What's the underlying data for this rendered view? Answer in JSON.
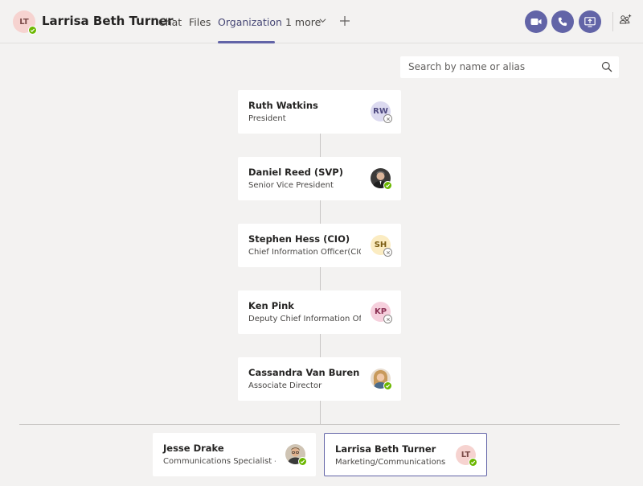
{
  "header": {
    "avatar_initials": "LT",
    "title": "Larrisa Beth Turner",
    "tabs": [
      {
        "label": "Chat"
      },
      {
        "label": "Files"
      },
      {
        "label": "Organization"
      },
      {
        "label": "1 more"
      }
    ]
  },
  "search": {
    "placeholder": "Search by name or alias"
  },
  "chain": [
    {
      "name": "Ruth Watkins",
      "role": "President",
      "initials": "RW",
      "avatar_color": "#dcdaf0",
      "initials_color": "#4f4a80",
      "status": "offline"
    },
    {
      "name": "Daniel Reed (SVP)",
      "role": "Senior Vice President",
      "initials": "",
      "avatar_color": "#3b3a39",
      "initials_color": "#ffffff",
      "status": "available"
    },
    {
      "name": "Stephen Hess (CIO)",
      "role": "Chief Information Officer(CIO)",
      "initials": "SH",
      "avatar_color": "#fbecc2",
      "initials_color": "#7a5c12",
      "status": "offline"
    },
    {
      "name": "Ken Pink",
      "role": "Deputy Chief Information Offic",
      "initials": "KP",
      "avatar_color": "#f6d0dd",
      "initials_color": "#8a2f52",
      "status": "offline"
    },
    {
      "name": "Cassandra Van Buren",
      "role": "Associate Director",
      "initials": "",
      "avatar_color": "#d8b48c",
      "initials_color": "#ffffff",
      "status": "available"
    }
  ],
  "peers": [
    {
      "name": "Jesse Drake",
      "role": "Communications Specialist - ...",
      "initials": "",
      "avatar_color": "#c9a27c",
      "initials_color": "#ffffff",
      "status": "available"
    },
    {
      "name": "Larrisa Beth Turner",
      "role": "Marketing/Communications S...",
      "initials": "LT",
      "avatar_color": "#f6d3d0",
      "initials_color": "#7a4a47",
      "status": "available"
    }
  ],
  "colors": {
    "accent": "#6264a7",
    "available": "#6bb700"
  }
}
